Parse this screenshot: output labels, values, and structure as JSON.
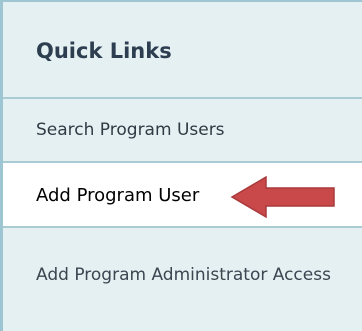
{
  "panel": {
    "title": "Quick Links",
    "links": [
      {
        "label": "Search Program Users"
      },
      {
        "label": "Add Program User"
      },
      {
        "label": "Add Program Administrator Access"
      }
    ]
  },
  "annotation": {
    "icon": "arrow-left-icon",
    "color": "#c9484a"
  }
}
